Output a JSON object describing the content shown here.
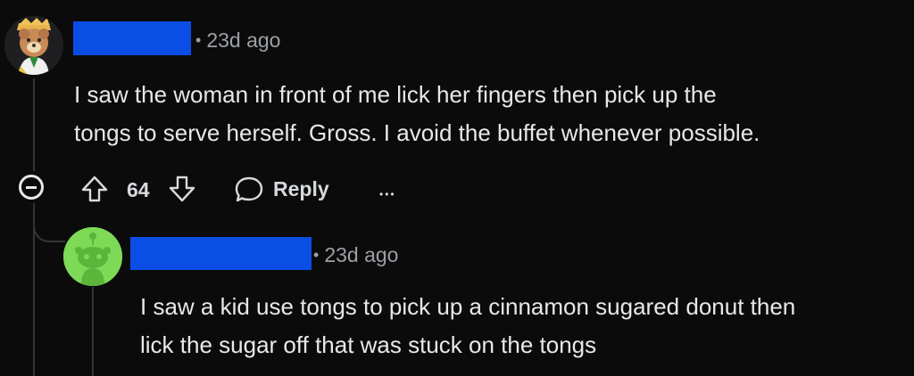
{
  "comment": {
    "time": "23d ago",
    "text_line1": "I saw the woman in front of me lick her fingers then pick up the",
    "text_line2": "tongs to serve herself. Gross. I avoid the buffet whenever possible.",
    "votes": "64",
    "reply_label": "Reply",
    "more_label": "•••"
  },
  "reply": {
    "time": "23d ago",
    "text_line1": "I saw a kid use tongs to pick up a cinnamon sugared donut then",
    "text_line2": "lick the sugar off that was stuck on the tongs"
  },
  "colors": {
    "background": "#0b0b0c",
    "redaction": "#0a4ee6",
    "avatar_green": "#7ed957",
    "thread_line": "#343536"
  }
}
